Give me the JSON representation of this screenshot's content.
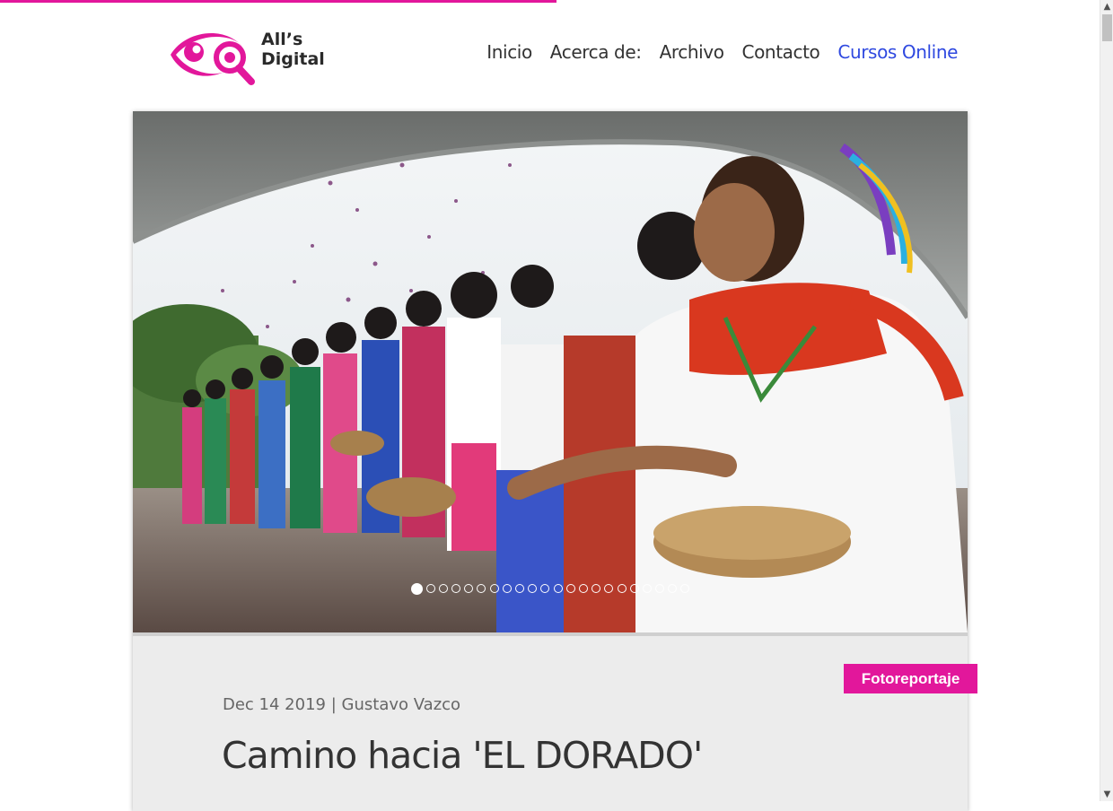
{
  "colors": {
    "brand": "#e2179b",
    "accent": "#2f49e0",
    "text": "#333333"
  },
  "logo": {
    "line1": "All’s",
    "line2": "Digital",
    "icon": "eye-magnifier-icon"
  },
  "nav": {
    "items": [
      {
        "label": "Inicio"
      },
      {
        "label": "Acerca de:"
      },
      {
        "label": "Archivo"
      },
      {
        "label": "Contacto"
      },
      {
        "label": "Cursos Online",
        "accent": true
      }
    ]
  },
  "reading_progress": 0.5,
  "slider": {
    "slide_count": 22,
    "active_index": 0
  },
  "post": {
    "category": "Fotoreportaje",
    "date": "Dec 14 2019",
    "separator": "|",
    "author": "Gustavo Vazco",
    "title": "Camino hacia 'EL DORADO'"
  }
}
